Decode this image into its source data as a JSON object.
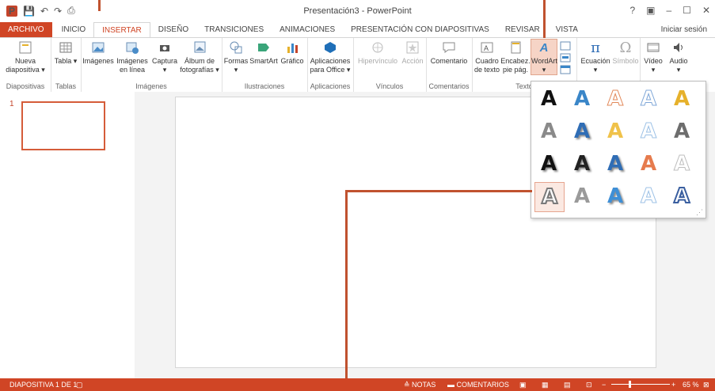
{
  "window": {
    "title": "Presentación3 - PowerPoint",
    "controls": [
      "?",
      "▣",
      "–",
      "☐",
      "✕"
    ],
    "sign_in": "Iniciar sesión"
  },
  "qat": {
    "logo": "P",
    "save": "💾",
    "undo": "↶",
    "redo": "↷",
    "start": "⎙"
  },
  "tabs": [
    "ARCHIVO",
    "INICIO",
    "INSERTAR",
    "DISEÑO",
    "TRANSICIONES",
    "ANIMACIONES",
    "PRESENTACIÓN CON DIAPOSITIVAS",
    "REVISAR",
    "VISTA"
  ],
  "active_tab": "INSERTAR",
  "ribbon": {
    "groups": [
      "Diapositivas",
      "Tablas",
      "Imágenes",
      "Ilustraciones",
      "Aplicaciones",
      "Vínculos",
      "Comentarios",
      "Texto"
    ],
    "buttons": {
      "nueva": "Nueva diapositiva ▾",
      "tabla": "Tabla ▾",
      "imagenes": "Imágenes",
      "imagenes_linea": "Imágenes en línea",
      "captura": "Captura ▾",
      "album": "Álbum de fotografías ▾",
      "formas": "Formas ▾",
      "smartart": "SmartArt",
      "grafico": "Gráfico",
      "aplicaciones": "Aplicaciones para Office ▾",
      "hipervinculo": "Hipervínculo",
      "accion": "Acción",
      "comentario": "Comentario",
      "cuadro": "Cuadro de texto",
      "encabez": "Encabez. pie pág.",
      "wordart": "WordArt ▾",
      "ecuacion": "Ecuación ▾",
      "simbolo": "Símbolo",
      "video": "Vídeo ▾",
      "audio": "Audio ▾"
    },
    "icons": {
      "ecuacion": "π",
      "simbolo": "Ω",
      "wordart": "A"
    }
  },
  "slides_pane": {
    "number": "1"
  },
  "wordart_gallery": {
    "rows": [
      [
        {
          "color": "#111111",
          "style": "fill"
        },
        {
          "color": "#3a86c8",
          "style": "fill"
        },
        {
          "color": "#e2895a",
          "style": "outline"
        },
        {
          "color": "#7fa7d8",
          "style": "outline"
        },
        {
          "color": "#e6b12b",
          "style": "fill"
        }
      ],
      [
        {
          "color": "#8a8a8a",
          "style": "fill"
        },
        {
          "color": "#2f6db5",
          "style": "shadow"
        },
        {
          "color": "#f0c24a",
          "style": "fill"
        },
        {
          "color": "#9cc1e6",
          "style": "outline"
        },
        {
          "color": "#6d6d6d",
          "style": "fill"
        }
      ],
      [
        {
          "color": "#111111",
          "style": "shadow"
        },
        {
          "color": "#222222",
          "style": "shadow"
        },
        {
          "color": "#2f6db5",
          "style": "shadow"
        },
        {
          "color": "#e67b4d",
          "style": "fill"
        },
        {
          "color": "#bdbdbd",
          "style": "outline"
        }
      ],
      [
        {
          "color": "#7a7a7a",
          "style": "pattern"
        },
        {
          "color": "#9a9a9a",
          "style": "fill"
        },
        {
          "color": "#3f8fd6",
          "style": "shadow"
        },
        {
          "color": "#9cc1e6",
          "style": "outline"
        },
        {
          "color": "#3a5fa0",
          "style": "pattern"
        }
      ]
    ],
    "glyph": "A",
    "resize_grip": "⋰"
  },
  "status": {
    "slide": "DIAPOSITIVA 1 DE 1",
    "notes": "≙ NOTAS",
    "comments": "▬ COMENTARIOS",
    "zoom": "65 %"
  },
  "colors": {
    "accent": "#d04525",
    "callout": "#c0522f"
  }
}
